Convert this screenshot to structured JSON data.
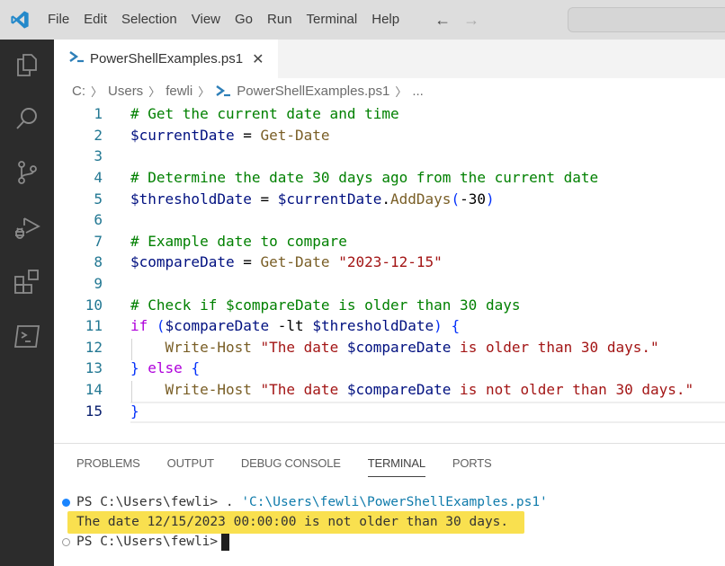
{
  "titlebar": {
    "menu": [
      "File",
      "Edit",
      "Selection",
      "View",
      "Go",
      "Run",
      "Terminal",
      "Help"
    ],
    "back_icon": "arrow-left",
    "forward_icon": "arrow-right"
  },
  "activitybar": {
    "items": [
      "explorer",
      "search",
      "source-control",
      "run-and-debug",
      "extensions",
      "terminal"
    ]
  },
  "tab": {
    "label": "PowerShellExamples.ps1",
    "close": "✕"
  },
  "breadcrumb": {
    "items": [
      "C:",
      "Users",
      "fewli",
      "PowerShellExamples.ps1",
      "..."
    ]
  },
  "editor": {
    "lines": [
      {
        "n": "1",
        "segments": [
          [
            "c",
            "# Get the current date and time"
          ]
        ]
      },
      {
        "n": "2",
        "segments": [
          [
            "v",
            "$currentDate"
          ],
          [
            "o",
            " = "
          ],
          [
            "m",
            "Get-Date"
          ]
        ]
      },
      {
        "n": "3",
        "segments": []
      },
      {
        "n": "4",
        "segments": [
          [
            "c",
            "# Determine the date 30 days ago from the current date"
          ]
        ]
      },
      {
        "n": "5",
        "segments": [
          [
            "v",
            "$thresholdDate"
          ],
          [
            "o",
            " = "
          ],
          [
            "v",
            "$currentDate"
          ],
          [
            "o",
            "."
          ],
          [
            "m",
            "AddDays"
          ],
          [
            "b",
            "("
          ],
          [
            "o",
            "-30"
          ],
          [
            "b",
            ")"
          ]
        ]
      },
      {
        "n": "6",
        "segments": []
      },
      {
        "n": "7",
        "segments": [
          [
            "c",
            "# Example date to compare"
          ]
        ]
      },
      {
        "n": "8",
        "segments": [
          [
            "v",
            "$compareDate"
          ],
          [
            "o",
            " = "
          ],
          [
            "m",
            "Get-Date"
          ],
          [
            "o",
            " "
          ],
          [
            "s",
            "\"2023-12-15\""
          ]
        ]
      },
      {
        "n": "9",
        "segments": []
      },
      {
        "n": "10",
        "segments": [
          [
            "c",
            "# Check if $compareDate is older than 30 days"
          ]
        ]
      },
      {
        "n": "11",
        "segments": [
          [
            "k",
            "if"
          ],
          [
            "o",
            " "
          ],
          [
            "b",
            "("
          ],
          [
            "v",
            "$compareDate"
          ],
          [
            "o",
            " -lt "
          ],
          [
            "v",
            "$thresholdDate"
          ],
          [
            "b",
            ")"
          ],
          [
            "o",
            " "
          ],
          [
            "b",
            "{"
          ]
        ]
      },
      {
        "n": "12",
        "segments": [
          [
            "o",
            "    "
          ],
          [
            "m",
            "Write-Host"
          ],
          [
            "o",
            " "
          ],
          [
            "s",
            "\"The date "
          ],
          [
            "v",
            "$compareDate"
          ],
          [
            "s",
            " is older than 30 days.\""
          ]
        ]
      },
      {
        "n": "13",
        "segments": [
          [
            "b",
            "}"
          ],
          [
            "o",
            " "
          ],
          [
            "k",
            "else"
          ],
          [
            "o",
            " "
          ],
          [
            "b",
            "{"
          ]
        ]
      },
      {
        "n": "14",
        "segments": [
          [
            "o",
            "    "
          ],
          [
            "m",
            "Write-Host"
          ],
          [
            "o",
            " "
          ],
          [
            "s",
            "\"The date "
          ],
          [
            "v",
            "$compareDate"
          ],
          [
            "s",
            " is not older than 30 days.\""
          ]
        ]
      },
      {
        "n": "15",
        "segments": [
          [
            "b",
            "}"
          ]
        ]
      }
    ],
    "active_line": "15"
  },
  "panel": {
    "tabs": [
      "PROBLEMS",
      "OUTPUT",
      "DEBUG CONSOLE",
      "TERMINAL",
      "PORTS"
    ],
    "active_tab": "TERMINAL"
  },
  "terminal": {
    "line1_prompt": "PS C:\\Users\\fewli> . ",
    "line1_path": "'C:\\Users\\fewli\\PowerShellExamples.ps1'",
    "line2_output": "The date 12/15/2023 00:00:00 is not older than 30 days.",
    "line3_prompt": "PS C:\\Users\\fewli>"
  },
  "colors": {
    "accent": "#007acc",
    "highlight": "#f9e04f",
    "comment": "#008000",
    "string": "#a31515",
    "variable": "#001080",
    "command": "#795e26",
    "keyword": "#af00db"
  }
}
